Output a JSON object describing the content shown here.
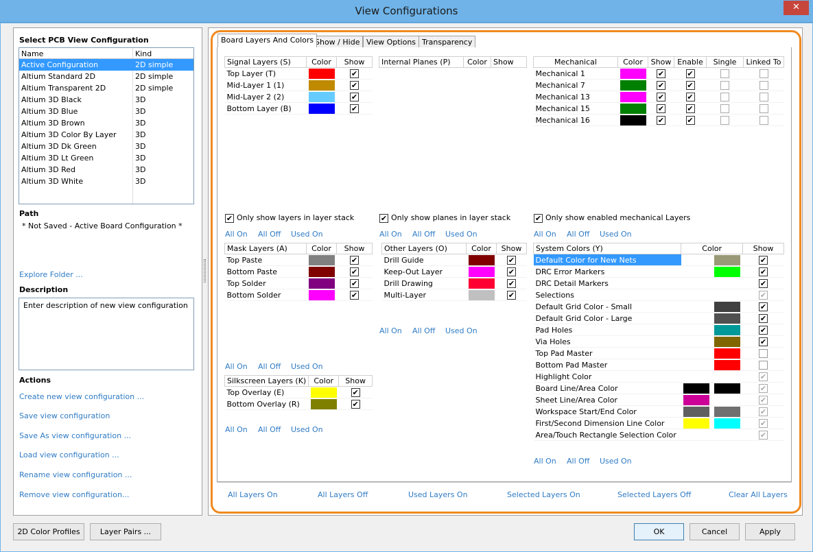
{
  "window": {
    "title": "View Configurations",
    "close": "✕"
  },
  "left": {
    "select_title": "Select PCB View Configuration",
    "columns": [
      "Name",
      "Kind"
    ],
    "configs": [
      [
        "Active Configuration",
        "2D simple"
      ],
      [
        "Altium Standard 2D",
        "2D simple"
      ],
      [
        "Altium Transparent 2D",
        "2D simple"
      ],
      [
        "Altium 3D Black",
        "3D"
      ],
      [
        "Altium 3D Blue",
        "3D"
      ],
      [
        "Altium 3D Brown",
        "3D"
      ],
      [
        "Altium 3D Color By Layer",
        "3D"
      ],
      [
        "Altium 3D Dk Green",
        "3D"
      ],
      [
        "Altium 3D Lt Green",
        "3D"
      ],
      [
        "Altium 3D Red",
        "3D"
      ],
      [
        "Altium 3D White",
        "3D"
      ]
    ],
    "path_title": "Path",
    "path_value": "* Not Saved - Active Board Configuration *",
    "explore": "Explore Folder ...",
    "desc_title": "Description",
    "desc_value": "Enter description of new view configuration",
    "actions_title": "Actions",
    "actions": [
      "Create new view configuration ...",
      "Save view configuration",
      "Save As view configuration ...",
      "Load view configuration ...",
      "Rename view configuration ...",
      "Remove view configuration..."
    ]
  },
  "tabs": [
    "Board Layers And Colors",
    "Show / Hide",
    "View Options",
    "Transparency"
  ],
  "common": {
    "all_on": "All On",
    "all_off": "All Off",
    "used_on": "Used On",
    "color": "Color",
    "show": "Show",
    "check": "✔"
  },
  "signal": {
    "header": "Signal Layers (S)",
    "rows": [
      {
        "name": "Top Layer (T)",
        "color": "#ff0000",
        "show": true
      },
      {
        "name": "Mid-Layer 1 (1)",
        "color": "#c08a00",
        "show": true
      },
      {
        "name": "Mid-Layer 2 (2)",
        "color": "#66ccff",
        "show": true
      },
      {
        "name": "Bottom Layer (B)",
        "color": "#0000ff",
        "show": true
      }
    ],
    "only": "Only show layers in layer stack"
  },
  "planes": {
    "header": "Internal Planes (P)",
    "only": "Only show planes in layer stack"
  },
  "mech": {
    "header": "Mechanical",
    "cols": [
      "Color",
      "Show",
      "Enable",
      "Single",
      "Linked To"
    ],
    "rows": [
      {
        "name": "Mechanical 1",
        "color": "#ff00ff"
      },
      {
        "name": "Mechanical 7",
        "color": "#008000"
      },
      {
        "name": "Mechanical 13",
        "color": "#ff00ff"
      },
      {
        "name": "Mechanical 15",
        "color": "#008000"
      },
      {
        "name": "Mechanical 16",
        "color": "#000000"
      }
    ],
    "only": "Only show enabled mechanical Layers"
  },
  "mask": {
    "header": "Mask Layers (A)",
    "rows": [
      {
        "name": "Top Paste",
        "color": "#808080"
      },
      {
        "name": "Bottom Paste",
        "color": "#800000"
      },
      {
        "name": "Top Solder",
        "color": "#800080"
      },
      {
        "name": "Bottom Solder",
        "color": "#ff00ff"
      }
    ]
  },
  "other": {
    "header": "Other Layers (O)",
    "rows": [
      {
        "name": "Drill Guide",
        "color": "#800000"
      },
      {
        "name": "Keep-Out Layer",
        "color": "#ff00ff"
      },
      {
        "name": "Drill Drawing",
        "color": "#ff0033"
      },
      {
        "name": "Multi-Layer",
        "color": "#c0c0c0"
      }
    ]
  },
  "silk": {
    "header": "Silkscreen Layers (K)",
    "rows": [
      {
        "name": "Top Overlay (E)",
        "color": "#ffff00"
      },
      {
        "name": "Bottom Overlay (R)",
        "color": "#808000"
      }
    ]
  },
  "system": {
    "header": "System Colors (Y)",
    "rows": [
      {
        "name": "Default Color for New Nets",
        "c1": "",
        "c2": "#999977",
        "show": "on"
      },
      {
        "name": "DRC Error Markers",
        "c1": "",
        "c2": "#00ff00",
        "show": "on"
      },
      {
        "name": "DRC Detail Markers",
        "c1": "",
        "c2": "",
        "show": "on"
      },
      {
        "name": "Selections",
        "c1": "",
        "c2": "",
        "show": "grey"
      },
      {
        "name": "Default Grid Color - Small",
        "c1": "",
        "c2": "#404040",
        "show": "on"
      },
      {
        "name": "Default Grid Color - Large",
        "c1": "",
        "c2": "#505050",
        "show": "on"
      },
      {
        "name": "Pad Holes",
        "c1": "",
        "c2": "#009999",
        "show": "on"
      },
      {
        "name": "Via Holes",
        "c1": "",
        "c2": "#806600",
        "show": "on"
      },
      {
        "name": "Top Pad Master",
        "c1": "",
        "c2": "#ff0000",
        "show": "off"
      },
      {
        "name": "Bottom Pad Master",
        "c1": "",
        "c2": "#ff0000",
        "show": "off"
      },
      {
        "name": "Highlight Color",
        "c1": "",
        "c2": "",
        "show": "grey"
      },
      {
        "name": "Board Line/Area Color",
        "c1": "#000000",
        "c2": "#000000",
        "show": "grey"
      },
      {
        "name": "Sheet Line/Area Color",
        "c1": "#cc0099",
        "c2": "",
        "show": "grey"
      },
      {
        "name": "Workspace Start/End Color",
        "c1": "#606060",
        "c2": "#707070",
        "show": "grey"
      },
      {
        "name": "First/Second Dimension Line Color",
        "c1": "#ffff00",
        "c2": "#00ffff",
        "show": "grey"
      },
      {
        "name": "Area/Touch Rectangle Selection Color",
        "c1": "",
        "c2": "",
        "show": "grey"
      }
    ]
  },
  "bottom_links": [
    "All Layers On",
    "All Layers Off",
    "Used Layers On",
    "Selected Layers On",
    "Selected Layers Off",
    "Clear All Layers"
  ],
  "buttons": {
    "color_profiles": "2D Color Profiles",
    "layer_pairs": "Layer Pairs ...",
    "ok": "OK",
    "cancel": "Cancel",
    "apply": "Apply"
  }
}
